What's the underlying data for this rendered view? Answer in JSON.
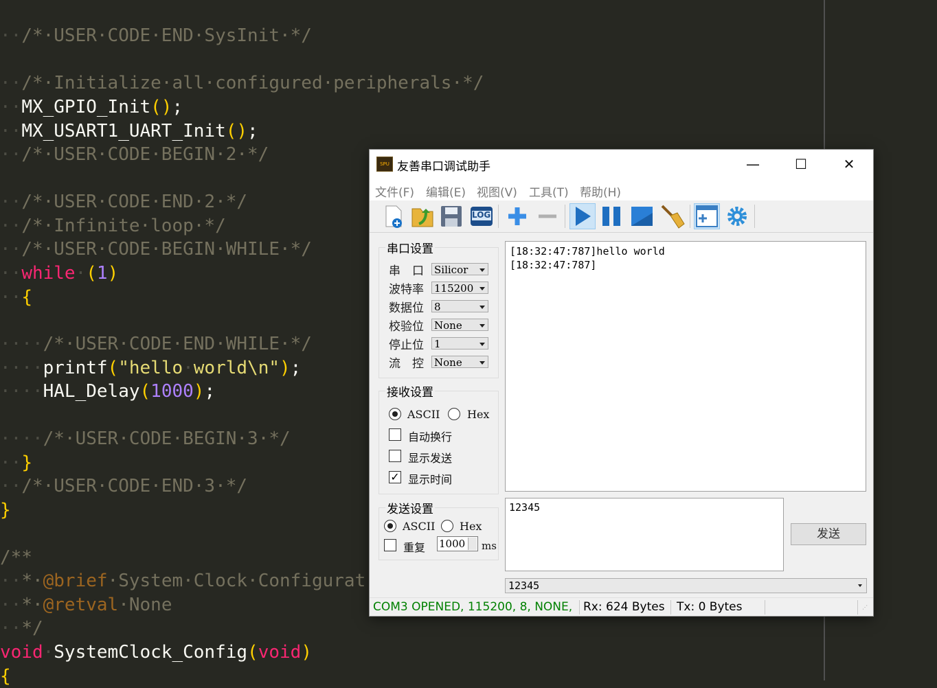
{
  "editor": {
    "lines": [
      {
        "ws": "··",
        "parts": [
          {
            "c": "cm",
            "t": "/*·USER·CODE·END·SysInit·*/"
          }
        ]
      },
      {
        "ws": "··",
        "parts": [
          {
            "c": "cm",
            "t": "/*·Initialize·all·configured·peripherals·*/"
          }
        ]
      },
      {
        "ws": "··",
        "parts": [
          {
            "c": "",
            "t": "MX_GPIO_Init"
          },
          {
            "c": "par",
            "t": "()"
          },
          {
            "c": "",
            "t": ";"
          }
        ]
      },
      {
        "ws": "··",
        "parts": [
          {
            "c": "",
            "t": "MX_USART1_UART_Init"
          },
          {
            "c": "par",
            "t": "()"
          },
          {
            "c": "",
            "t": ";"
          }
        ]
      },
      {
        "ws": "··",
        "parts": [
          {
            "c": "cm",
            "t": "/*·USER·CODE·BEGIN·2·*/"
          }
        ]
      },
      {
        "ws": "··",
        "parts": [
          {
            "c": "cm",
            "t": "/*·USER·CODE·END·2·*/"
          }
        ]
      },
      {
        "ws": "··",
        "parts": [
          {
            "c": "cm",
            "t": "/*·Infinite·loop·*/"
          }
        ]
      },
      {
        "ws": "··",
        "parts": [
          {
            "c": "cm",
            "t": "/*·USER·CODE·BEGIN·WHILE·*/"
          }
        ]
      },
      {
        "ws": "··",
        "parts": [
          {
            "c": "kw",
            "t": "while"
          },
          {
            "c": "ws",
            "t": "·"
          },
          {
            "c": "par",
            "t": "("
          },
          {
            "c": "num",
            "t": "1"
          },
          {
            "c": "par",
            "t": ")"
          }
        ]
      },
      {
        "ws": "··",
        "parts": [
          {
            "c": "par",
            "t": "{"
          }
        ]
      },
      {
        "ws": "····",
        "parts": [
          {
            "c": "cm",
            "t": "/*·USER·CODE·END·WHILE·*/"
          }
        ]
      },
      {
        "ws": "····",
        "parts": [
          {
            "c": "",
            "t": "printf"
          },
          {
            "c": "par",
            "t": "("
          },
          {
            "c": "str",
            "t": "\"hello"
          },
          {
            "c": "ws",
            "t": "·"
          },
          {
            "c": "str",
            "t": "world\\n\""
          },
          {
            "c": "par",
            "t": ")"
          },
          {
            "c": "",
            "t": ";"
          }
        ]
      },
      {
        "ws": "····",
        "parts": [
          {
            "c": "",
            "t": "HAL_Delay"
          },
          {
            "c": "par",
            "t": "("
          },
          {
            "c": "num",
            "t": "1000"
          },
          {
            "c": "par",
            "t": ")"
          },
          {
            "c": "",
            "t": ";"
          }
        ]
      },
      {
        "ws": "····",
        "parts": [
          {
            "c": "cm",
            "t": "/*·USER·CODE·BEGIN·3·*/"
          }
        ]
      },
      {
        "ws": "··",
        "parts": [
          {
            "c": "par",
            "t": "}"
          }
        ]
      },
      {
        "ws": "··",
        "parts": [
          {
            "c": "cm",
            "t": "/*·USER·CODE·END·3·*/"
          }
        ]
      },
      {
        "ws": "",
        "parts": [
          {
            "c": "par",
            "t": "}"
          }
        ]
      },
      {
        "ws": "",
        "parts": [
          {
            "c": "cm",
            "t": "/**"
          }
        ]
      },
      {
        "ws": "··",
        "parts": [
          {
            "c": "cm",
            "t": "*·"
          },
          {
            "c": "tag",
            "t": "@brief"
          },
          {
            "c": "cm",
            "t": "·System·Clock·Configurat"
          }
        ]
      },
      {
        "ws": "··",
        "parts": [
          {
            "c": "cm",
            "t": "*·"
          },
          {
            "c": "tag",
            "t": "@retval"
          },
          {
            "c": "cm",
            "t": "·None"
          }
        ]
      },
      {
        "ws": "··",
        "parts": [
          {
            "c": "cm",
            "t": "*/"
          }
        ]
      },
      {
        "ws": "",
        "parts": [
          {
            "c": "kw",
            "t": "void"
          },
          {
            "c": "ws",
            "t": "·"
          },
          {
            "c": "",
            "t": "SystemClock_Config"
          },
          {
            "c": "par",
            "t": "("
          },
          {
            "c": "kw",
            "t": "void"
          },
          {
            "c": "par",
            "t": ")"
          }
        ]
      },
      {
        "ws": "",
        "parts": [
          {
            "c": "par",
            "t": "{"
          }
        ]
      }
    ]
  },
  "dialog": {
    "title": "友善串口调试助手",
    "app_icon_text": "SPU",
    "window_buttons": {
      "minimize": "—",
      "maximize": "☐",
      "close": "✕"
    },
    "menu": [
      "文件(F)",
      "编辑(E)",
      "视图(V)",
      "工具(T)",
      "帮助(H)"
    ],
    "toolbar": {
      "log_label": "LOG"
    },
    "serial": {
      "title": "串口设置",
      "rows": [
        {
          "label": "串　口",
          "value": "Silicor"
        },
        {
          "label": "波特率",
          "value": "115200"
        },
        {
          "label": "数据位",
          "value": "8"
        },
        {
          "label": "校验位",
          "value": "None"
        },
        {
          "label": "停止位",
          "value": "1"
        },
        {
          "label": "流　控",
          "value": "None"
        }
      ]
    },
    "receive": {
      "title": "接收设置",
      "ascii": "ASCII",
      "hex": "Hex",
      "auto_wrap": "自动换行",
      "show_send": "显示发送",
      "show_time": "显示时间"
    },
    "send": {
      "title": "发送设置",
      "ascii": "ASCII",
      "hex": "Hex",
      "repeat": "重复",
      "interval": "1000",
      "unit": "ms",
      "button": "发送"
    },
    "recv_text": "[18:32:47:787]hello world\n[18:32:47:787]",
    "send_text": "12345",
    "history_value": "12345",
    "status": {
      "port": "COM3 OPENED, 115200, 8, NONE,",
      "rx": "Rx: 624 Bytes",
      "tx": "Tx: 0 Bytes",
      "port_color": "#008000"
    }
  }
}
